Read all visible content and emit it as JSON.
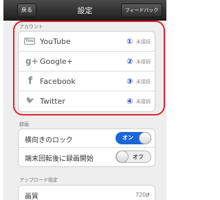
{
  "nav": {
    "back_label": "戻る",
    "title": "設定",
    "feedback_label": "フィードバック"
  },
  "accounts": {
    "header": "アカウント",
    "items": [
      {
        "icon": "youtube-icon",
        "glyph": "You",
        "label": "YouTube",
        "num": "①",
        "status": "未接続"
      },
      {
        "icon": "google-plus-icon",
        "glyph": "g+",
        "label": "Google+",
        "num": "②",
        "status": "未接続"
      },
      {
        "icon": "facebook-icon",
        "glyph": "f",
        "label": "Facebook",
        "num": "③",
        "status": "未接続"
      },
      {
        "icon": "twitter-icon",
        "glyph": "🐦",
        "label": "Twitter",
        "num": "④",
        "status": "未接続"
      }
    ]
  },
  "recording": {
    "header": "録画",
    "items": [
      {
        "label": "横向きのロック",
        "toggle": "オン",
        "state": "on"
      },
      {
        "label": "端末回転後に録画開始",
        "toggle": "オフ",
        "state": "off"
      }
    ]
  },
  "upload": {
    "header": "アップロード設定",
    "quality_label": "画質",
    "quality_value": "720p"
  },
  "colors": {
    "highlight": "#e01e2d",
    "number": "#1a39d8",
    "toggle_on": "#1b67d6"
  }
}
